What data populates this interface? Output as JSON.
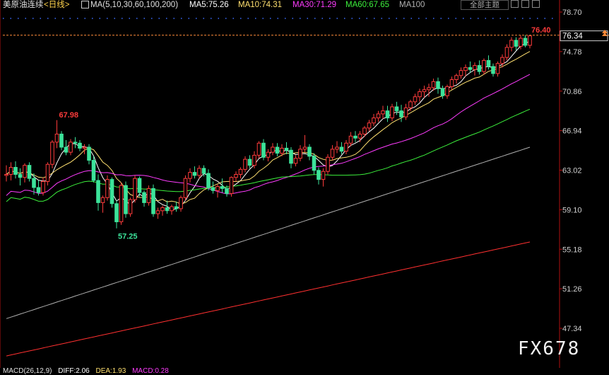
{
  "header": {
    "title": "美原油连续",
    "period": "<日线>",
    "ma_params": "MA(5,10,30,60,100,200)",
    "ma5": "MA5:75.26",
    "ma10": "MA10:74.31",
    "ma30": "MA30:71.29",
    "ma60": "MA60:67.65",
    "ma100": "MA100",
    "theme_button": "全部主题"
  },
  "colors": {
    "up": "#ff3b3b",
    "down": "#3ce39a",
    "ma5": "#ffffff",
    "ma10": "#ffe070",
    "ma30": "#ff3cff",
    "ma60": "#3cf03c",
    "ma100": "#b0b0b0",
    "ma200": "#ff3030",
    "axis": "#b01010"
  },
  "chart_data": {
    "type": "candlestick",
    "y_ticks": [
      "78.70",
      "74.78",
      "70.86",
      "66.94",
      "63.02",
      "59.10",
      "55.18",
      "51.26",
      "47.34"
    ],
    "ylim": [
      45.4,
      78.7
    ],
    "last_price": "76.34",
    "annotations": {
      "high": "76.40",
      "peak": "67.98",
      "low": "57.25"
    },
    "ohlc": [
      [
        62.5,
        63.5,
        61.9,
        62.6
      ],
      [
        62.6,
        63.8,
        62.0,
        63.3
      ],
      [
        63.3,
        63.9,
        62.2,
        62.6
      ],
      [
        62.6,
        63.2,
        61.5,
        62.3
      ],
      [
        62.3,
        63.7,
        61.8,
        63.5
      ],
      [
        63.5,
        63.8,
        61.9,
        62.2
      ],
      [
        62.2,
        62.7,
        60.6,
        61.3
      ],
      [
        61.3,
        62.0,
        60.5,
        60.8
      ],
      [
        60.8,
        62.3,
        60.5,
        61.9
      ],
      [
        61.9,
        63.8,
        61.5,
        63.6
      ],
      [
        63.6,
        66.0,
        63.2,
        65.8
      ],
      [
        65.8,
        67.98,
        65.2,
        66.6
      ],
      [
        66.6,
        66.9,
        65.0,
        65.3
      ],
      [
        65.3,
        66.0,
        64.5,
        64.8
      ],
      [
        64.8,
        66.1,
        64.5,
        65.8
      ],
      [
        65.8,
        66.3,
        65.2,
        65.7
      ],
      [
        65.7,
        66.0,
        64.9,
        65.2
      ],
      [
        65.2,
        65.6,
        64.6,
        65.3
      ],
      [
        65.3,
        65.6,
        63.6,
        64.0
      ],
      [
        64.0,
        64.4,
        61.8,
        62.0
      ],
      [
        62.0,
        62.6,
        59.0,
        59.8
      ],
      [
        59.8,
        60.5,
        58.8,
        60.3
      ],
      [
        60.3,
        62.5,
        60.0,
        62.1
      ],
      [
        62.1,
        62.3,
        59.3,
        59.7
      ],
      [
        59.7,
        60.0,
        57.25,
        57.9
      ],
      [
        57.9,
        61.8,
        57.6,
        61.5
      ],
      [
        61.5,
        61.9,
        58.3,
        58.7
      ],
      [
        58.7,
        60.3,
        58.4,
        60.1
      ],
      [
        60.1,
        62.5,
        59.8,
        62.2
      ],
      [
        62.2,
        62.4,
        60.4,
        60.8
      ],
      [
        60.8,
        61.0,
        59.4,
        59.8
      ],
      [
        59.8,
        61.5,
        59.5,
        61.2
      ],
      [
        61.2,
        61.6,
        58.4,
        58.7
      ],
      [
        58.7,
        59.3,
        58.2,
        59.0
      ],
      [
        59.0,
        59.5,
        58.5,
        59.3
      ],
      [
        59.3,
        60.0,
        58.7,
        59.0
      ],
      [
        59.0,
        59.6,
        58.6,
        59.4
      ],
      [
        59.4,
        59.9,
        58.9,
        59.2
      ],
      [
        59.2,
        60.5,
        58.9,
        60.3
      ],
      [
        60.3,
        62.5,
        60.0,
        62.2
      ],
      [
        62.2,
        63.2,
        61.8,
        62.8
      ],
      [
        62.8,
        63.4,
        62.2,
        62.5
      ],
      [
        62.5,
        63.5,
        62.2,
        63.2
      ],
      [
        63.2,
        63.5,
        62.4,
        62.7
      ],
      [
        62.7,
        63.1,
        61.0,
        61.3
      ],
      [
        61.3,
        61.9,
        60.7,
        61.0
      ],
      [
        61.0,
        61.6,
        60.3,
        61.4
      ],
      [
        61.4,
        62.2,
        60.8,
        61.2
      ],
      [
        61.2,
        61.5,
        60.4,
        60.7
      ],
      [
        60.7,
        62.4,
        60.4,
        62.3
      ],
      [
        62.3,
        62.9,
        61.9,
        62.6
      ],
      [
        62.6,
        63.3,
        62.2,
        63.1
      ],
      [
        63.1,
        64.4,
        62.8,
        64.1
      ],
      [
        64.1,
        64.5,
        63.2,
        63.5
      ],
      [
        63.5,
        64.9,
        63.2,
        64.5
      ],
      [
        64.5,
        65.9,
        64.2,
        65.7
      ],
      [
        65.7,
        66.1,
        64.0,
        64.3
      ],
      [
        64.3,
        65.1,
        63.9,
        64.8
      ],
      [
        64.8,
        65.7,
        64.5,
        65.3
      ],
      [
        65.3,
        65.7,
        64.4,
        64.7
      ],
      [
        64.7,
        65.6,
        64.4,
        65.2
      ],
      [
        65.2,
        65.8,
        64.6,
        65.0
      ],
      [
        65.0,
        65.3,
        63.2,
        63.7
      ],
      [
        63.7,
        64.5,
        63.4,
        64.2
      ],
      [
        64.2,
        65.5,
        63.9,
        65.1
      ],
      [
        65.1,
        66.5,
        64.8,
        65.3
      ],
      [
        65.3,
        65.6,
        64.0,
        64.4
      ],
      [
        64.4,
        64.7,
        62.6,
        63.0
      ],
      [
        63.0,
        63.3,
        61.6,
        62.1
      ],
      [
        62.1,
        63.2,
        61.4,
        62.9
      ],
      [
        62.9,
        64.6,
        62.6,
        64.3
      ],
      [
        64.3,
        65.5,
        64.0,
        65.1
      ],
      [
        65.1,
        65.9,
        64.7,
        65.3
      ],
      [
        65.3,
        65.8,
        64.6,
        64.9
      ],
      [
        64.9,
        66.0,
        64.6,
        65.7
      ],
      [
        65.7,
        66.8,
        65.4,
        66.4
      ],
      [
        66.4,
        66.9,
        65.8,
        66.2
      ],
      [
        66.2,
        66.9,
        65.8,
        66.6
      ],
      [
        66.6,
        67.4,
        66.3,
        67.2
      ],
      [
        67.2,
        68.0,
        66.9,
        67.7
      ],
      [
        67.7,
        68.6,
        67.4,
        68.2
      ],
      [
        68.2,
        68.9,
        67.8,
        68.6
      ],
      [
        68.6,
        69.4,
        68.1,
        68.9
      ],
      [
        68.9,
        69.4,
        67.8,
        68.2
      ],
      [
        68.2,
        69.6,
        67.9,
        69.3
      ],
      [
        69.3,
        69.8,
        68.5,
        68.9
      ],
      [
        68.9,
        69.5,
        67.8,
        68.3
      ],
      [
        68.3,
        69.6,
        68.0,
        69.2
      ],
      [
        69.2,
        70.0,
        68.9,
        69.8
      ],
      [
        69.8,
        70.6,
        69.5,
        70.3
      ],
      [
        70.3,
        71.1,
        69.8,
        70.8
      ],
      [
        70.8,
        71.4,
        70.2,
        71.0
      ],
      [
        71.0,
        71.6,
        70.3,
        71.2
      ],
      [
        71.2,
        72.1,
        70.9,
        71.8
      ],
      [
        71.8,
        72.2,
        70.6,
        71.1
      ],
      [
        71.1,
        71.4,
        70.1,
        70.4
      ],
      [
        70.4,
        71.5,
        70.1,
        71.3
      ],
      [
        71.3,
        72.3,
        71.0,
        72.0
      ],
      [
        72.0,
        72.6,
        71.6,
        72.4
      ],
      [
        72.4,
        73.2,
        72.1,
        72.9
      ],
      [
        72.9,
        73.5,
        72.3,
        73.2
      ],
      [
        73.2,
        73.8,
        72.7,
        73.0
      ],
      [
        73.0,
        73.7,
        72.4,
        73.4
      ],
      [
        73.4,
        73.9,
        72.5,
        72.8
      ],
      [
        72.8,
        74.1,
        72.5,
        73.9
      ],
      [
        73.9,
        74.4,
        73.0,
        73.3
      ],
      [
        73.3,
        73.6,
        72.3,
        72.6
      ],
      [
        72.6,
        73.8,
        72.3,
        73.6
      ],
      [
        73.6,
        74.5,
        73.2,
        74.2
      ],
      [
        74.2,
        75.5,
        73.9,
        75.2
      ],
      [
        75.2,
        76.2,
        74.8,
        75.9
      ],
      [
        75.9,
        76.2,
        74.9,
        75.3
      ],
      [
        75.3,
        76.4,
        75.0,
        76.1
      ],
      [
        76.1,
        76.4,
        75.2,
        75.4
      ],
      [
        75.4,
        76.4,
        75.1,
        76.34
      ]
    ]
  },
  "watermark": "FX678",
  "macd": {
    "label": "MACD(26,12,9)",
    "diff": "DIFF:2.06",
    "dea": "DEA:1.93",
    "macd": "MACD:0.28"
  }
}
